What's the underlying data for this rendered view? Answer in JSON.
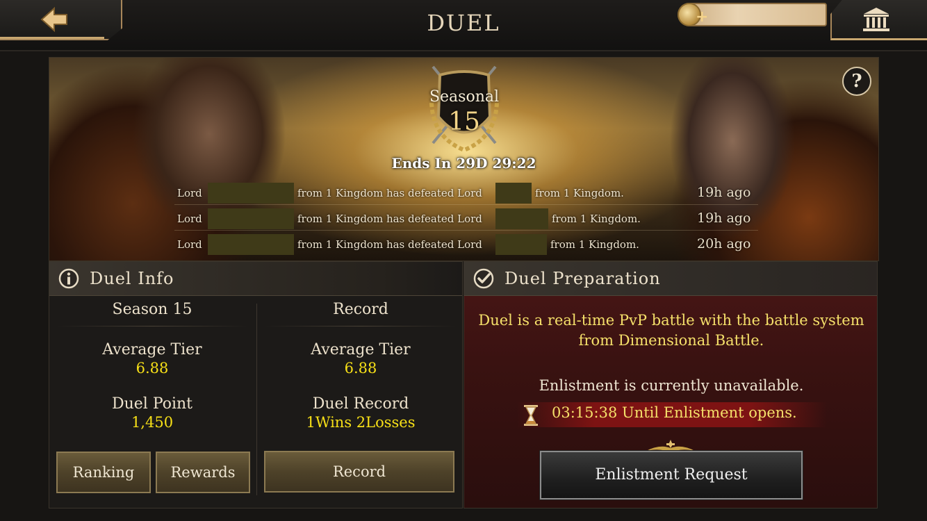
{
  "header": {
    "title": "DUEL",
    "back_icon": "back-arrow-icon",
    "currency_value": "",
    "bank_icon": "bank-icon"
  },
  "banner": {
    "season_label": "Seasonal",
    "season_number": "15",
    "ends_in": "Ends In 29D 29:22",
    "help": "?",
    "logs": [
      {
        "prefix": "Lord",
        "middle": "from 1 Kingdom has defeated Lord",
        "suffix": "from 1 Kingdom.",
        "time": "19h ago"
      },
      {
        "prefix": "Lord",
        "middle": "from 1 Kingdom has defeated Lord",
        "suffix": "from 1 Kingdom.",
        "time": "19h ago"
      },
      {
        "prefix": "Lord",
        "middle": "from 1 Kingdom has defeated Lord",
        "suffix": "from 1 Kingdom.",
        "time": "20h ago"
      }
    ]
  },
  "duel_info": {
    "title": "Duel Info",
    "season": {
      "heading": "Season 15",
      "avg_tier_label": "Average Tier",
      "avg_tier_value": "6.88",
      "point_label": "Duel Point",
      "point_value": "1,450"
    },
    "record": {
      "heading": "Record",
      "avg_tier_label": "Average Tier",
      "avg_tier_value": "6.88",
      "record_label": "Duel Record",
      "record_value": "1Wins 2Losses"
    },
    "buttons": {
      "ranking": "Ranking",
      "rewards": "Rewards",
      "record": "Record"
    }
  },
  "duel_prep": {
    "title": "Duel Preparation",
    "description": "Duel is a real-time PvP battle with the battle system from Dimensional Battle.",
    "status": "Enlistment is currently unavailable.",
    "timer": "03:15:38 Until Enlistment opens.",
    "button": "Enlistment Request"
  },
  "colors": {
    "accent_gold": "#c9a870",
    "value_yellow": "#f7e017",
    "prep_bg": "#3a1211"
  }
}
